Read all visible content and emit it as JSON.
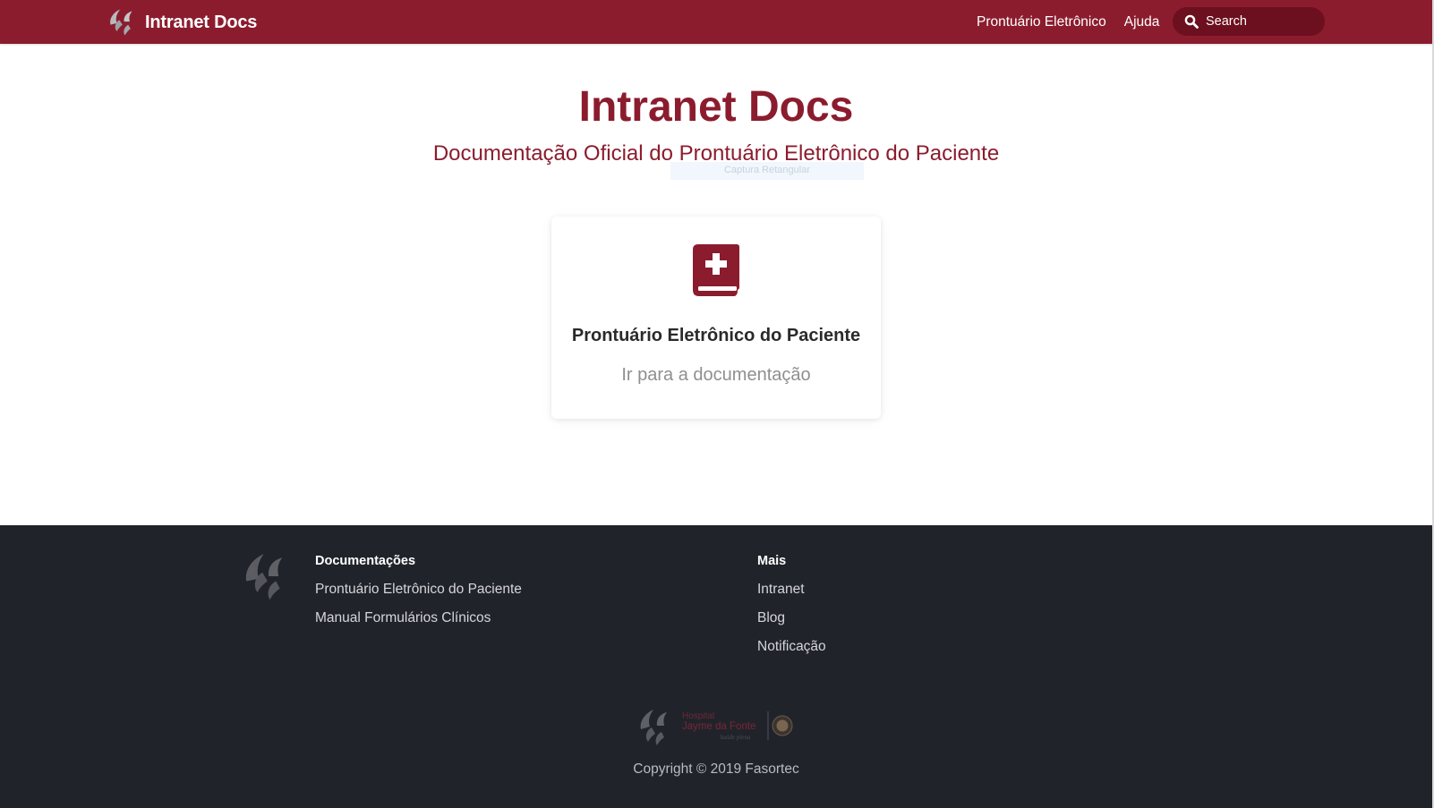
{
  "navbar": {
    "brand_title": "Intranet Docs",
    "links": [
      {
        "label": "Prontuário Eletrônico"
      },
      {
        "label": "Ajuda"
      }
    ],
    "search": {
      "placeholder": "Search",
      "value": ""
    },
    "color": "#8b1c2e"
  },
  "hero": {
    "title": "Intranet Docs",
    "subtitle": "Documentação Oficial do Prontuário Eletrônico do Paciente",
    "capture_hint": "Captura Retangular"
  },
  "card": {
    "icon": "medical-book-icon",
    "title": "Prontuário Eletrônico do Paciente",
    "link_label": "Ir para a documentação"
  },
  "footer": {
    "columns": [
      {
        "heading": "Documentações",
        "links": [
          "Prontuário Eletrônico do Paciente",
          "Manual Formulários Clínicos"
        ]
      },
      {
        "heading": "Mais",
        "links": [
          "Intranet",
          "Blog",
          "Notificação"
        ]
      }
    ],
    "badge": {
      "line1": "Hospital",
      "line2": "Jayme da Fonte",
      "line3": "Saúde plena"
    },
    "copyright": "Copyright © 2019 Fasortec",
    "background": "#21232b"
  }
}
